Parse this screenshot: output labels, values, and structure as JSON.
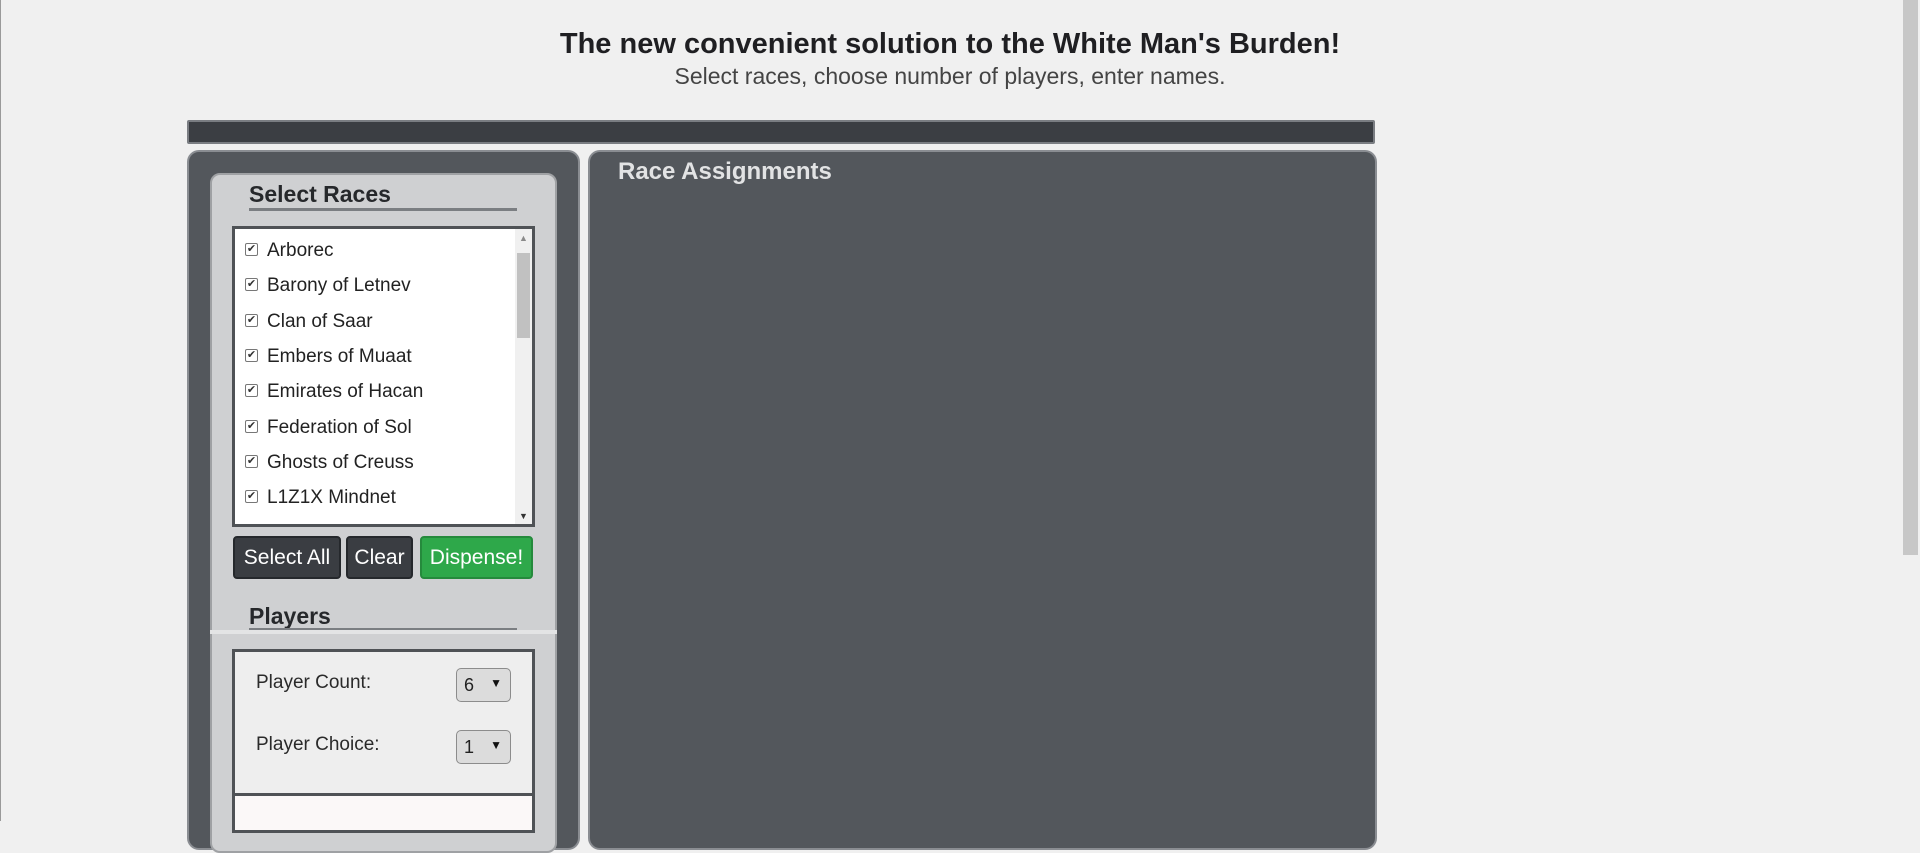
{
  "header": {
    "title": "The new convenient solution to the White Man's Burden!",
    "subtitle": "Select races, choose number of players, enter names."
  },
  "select_races": {
    "heading": "Select Races",
    "races": [
      {
        "label": "Arborec",
        "checked": true
      },
      {
        "label": "Barony of Letnev",
        "checked": true
      },
      {
        "label": "Clan of Saar",
        "checked": true
      },
      {
        "label": "Embers of Muaat",
        "checked": true
      },
      {
        "label": "Emirates of Hacan",
        "checked": true
      },
      {
        "label": "Federation of Sol",
        "checked": true
      },
      {
        "label": "Ghosts of Creuss",
        "checked": true
      },
      {
        "label": "L1Z1X Mindnet",
        "checked": true
      }
    ],
    "checkmark": "✔",
    "scroll_up": "▲",
    "scroll_down": "▼"
  },
  "buttons": {
    "select_all": "Select All",
    "clear": "Clear",
    "dispense": "Dispense!"
  },
  "players": {
    "heading": "Players",
    "count_label": "Player Count:",
    "count_value": "6",
    "choice_label": "Player Choice:",
    "choice_value": "1",
    "caret": "▼"
  },
  "race_assignments": {
    "heading": "Race Assignments"
  },
  "colors": {
    "panel_dark": "#53575c",
    "panel_light": "#cfd0d2",
    "button_dark": "#3a3d42",
    "button_green": "#2ea84a"
  }
}
